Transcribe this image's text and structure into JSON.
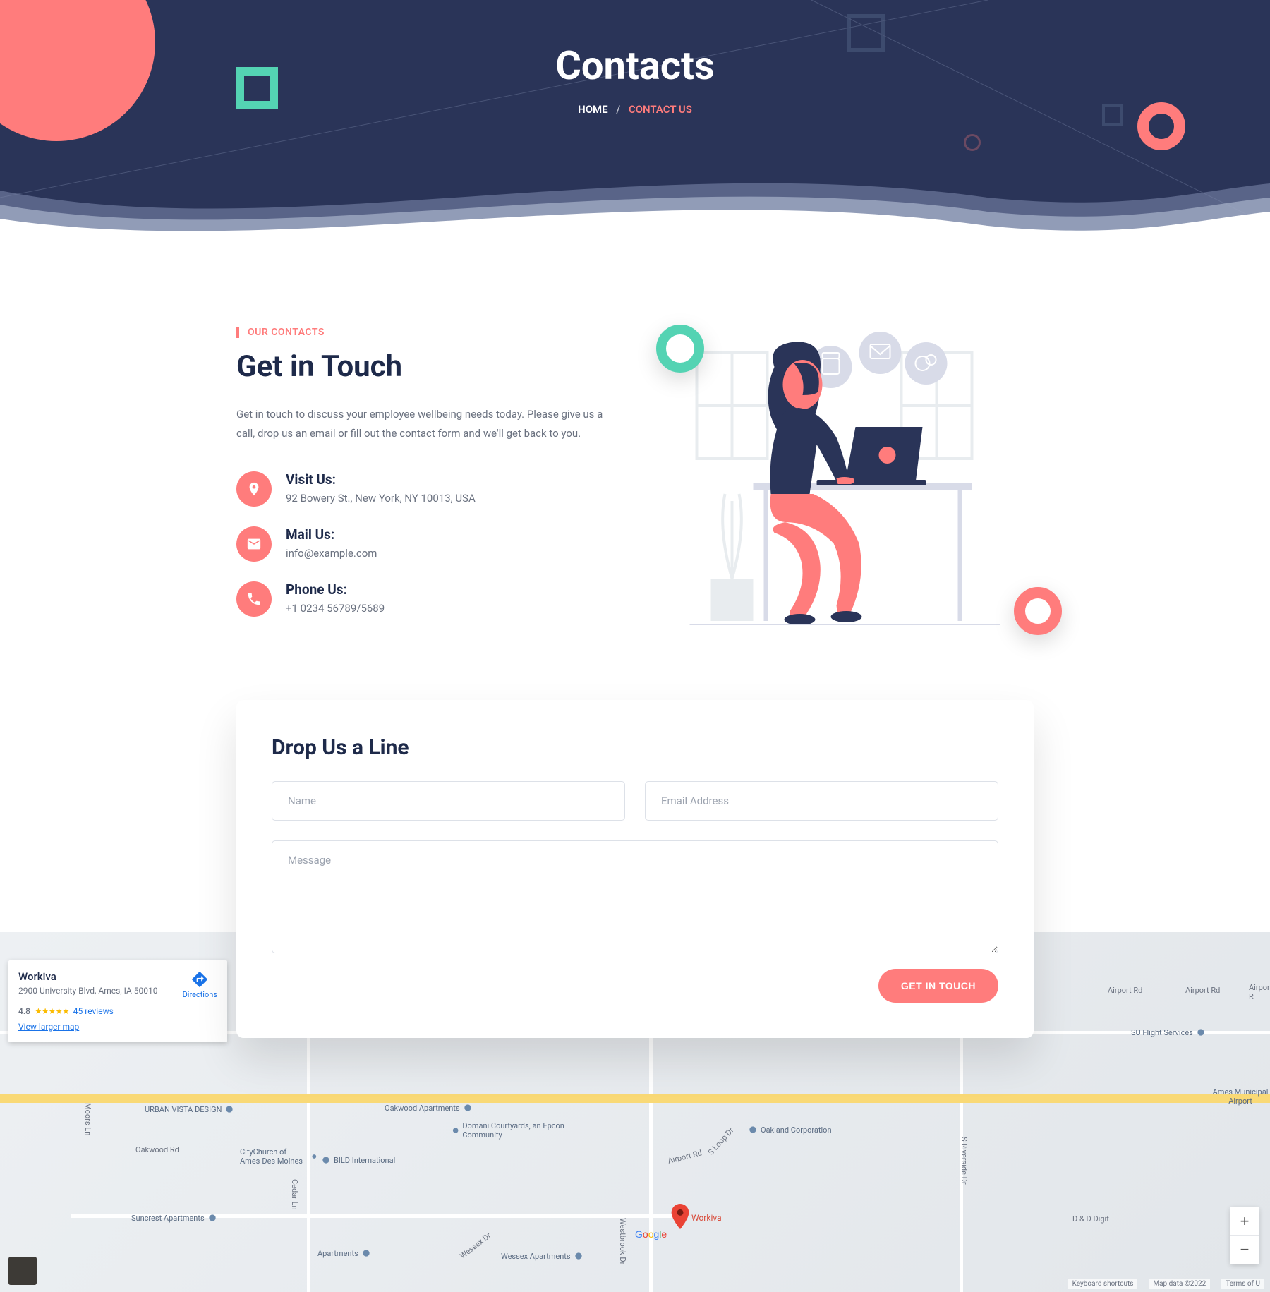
{
  "hero": {
    "title": "Contacts",
    "breadcrumb": {
      "home": "HOME",
      "current": "CONTACT US"
    }
  },
  "contacts": {
    "tag": "OUR CONTACTS",
    "title": "Get in Touch",
    "text": "Get in touch to discuss your employee wellbeing needs today. Please give us a call, drop us an email or fill out the contact form and we'll get back to you.",
    "visit": {
      "label": "Visit Us:",
      "value": "92 Bowery St., New York, NY 10013, USA"
    },
    "mail": {
      "label": "Mail Us:",
      "value": "info@example.com"
    },
    "phone": {
      "label": "Phone Us:",
      "value": "+1 0234 56789/5689"
    }
  },
  "form": {
    "title": "Drop Us a Line",
    "name_placeholder": "Name",
    "email_placeholder": "Email Address",
    "message_placeholder": "Message",
    "submit": "GET IN TOUCH"
  },
  "map": {
    "card": {
      "title": "Workiva",
      "address": "2900 University Blvd, Ames, IA 50010",
      "directions": "Directions",
      "rating": "4.8",
      "stars": "★★★★★",
      "reviews": "45 reviews",
      "view_larger": "View larger map"
    },
    "workiva_pin": "Workiva",
    "zoom_in": "+",
    "zoom_out": "−",
    "footer": {
      "keyboard": "Keyboard shortcuts",
      "mapdata": "Map data ©2022",
      "terms": "Terms of U"
    },
    "labels": {
      "airport_rd": "Airport Rd",
      "airport_rd2": "Airport Rd",
      "airport_rd3": "Airport R",
      "isu_flight": "ISU Flight Services",
      "ames_airport": "Ames Municipal Airport",
      "dd_digit": "D & D Digit",
      "oakland": "Oakland Corporation",
      "s_loop": "S Loop Dr",
      "s_riverside": "S Riverside Dr",
      "oakwood_rd": "Oakwood Rd",
      "oakwood_apts": "Oakwood Apartments",
      "domani": "Domani Courtyards, an Epcon Community",
      "bild": "BILD International",
      "citychurch": "CityChurch of Ames-Des Moines",
      "urban_vista": "URBAN VISTA DESIGN",
      "suncrest": "Suncrest Apartments",
      "apartments": "Apartments",
      "wessex": "Wessex Apartments",
      "wessex_dr": "Wessex Dr",
      "westbrook": "Westbrook Dr",
      "cedar_ln": "Cedar Ln",
      "moors_ln": "Moors Ln",
      "airport_rd4": "Airport Rd"
    }
  }
}
